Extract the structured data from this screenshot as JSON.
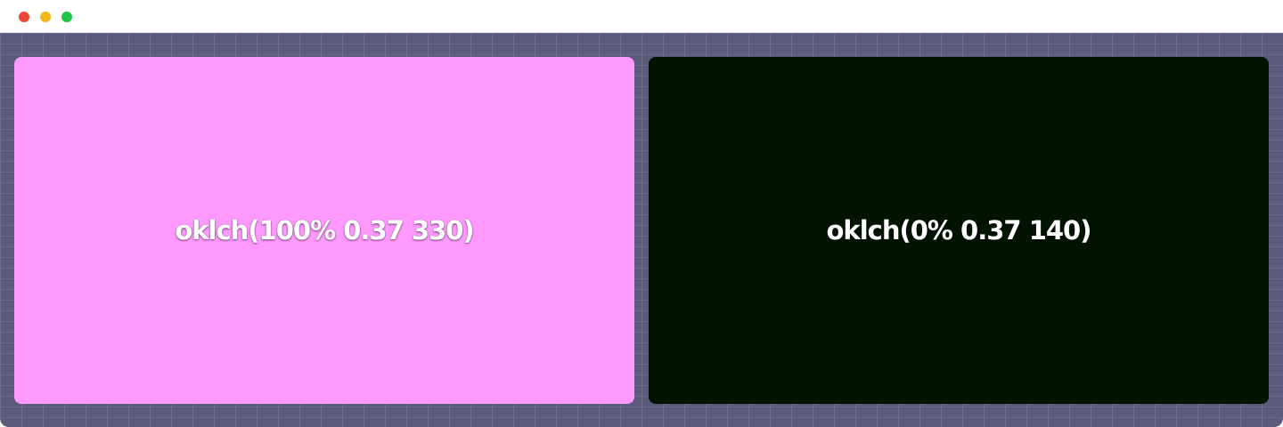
{
  "window_controls": [
    {
      "name": "close",
      "color": "#e9493b"
    },
    {
      "name": "minimize",
      "color": "#f4b719"
    },
    {
      "name": "maximize",
      "color": "#21c442"
    }
  ],
  "swatches": [
    {
      "label": "oklch(100% 0.37 330)",
      "color": "#ff99ff"
    },
    {
      "label": "oklch(0% 0.37 140)",
      "color": "#001400"
    }
  ]
}
